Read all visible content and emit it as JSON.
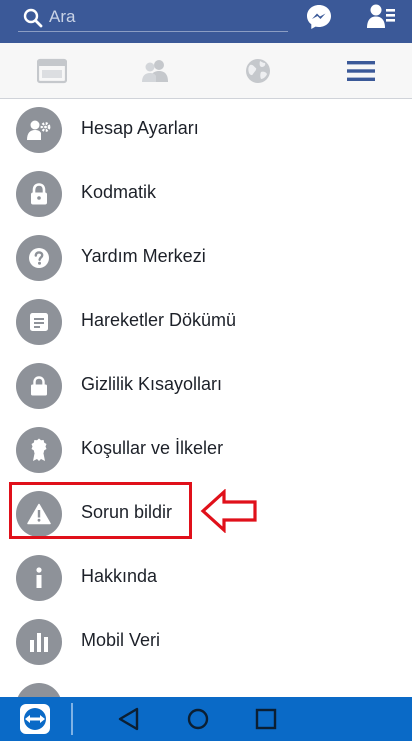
{
  "search": {
    "placeholder": "Ara"
  },
  "icons": {
    "search": "search-icon",
    "messenger": "messenger-icon",
    "friend_requests": "friend-requests-icon",
    "feed_tab": "news-feed-icon",
    "friends_tab": "friends-icon",
    "notifications_tab": "globe-icon",
    "menu_tab": "hamburger-menu-icon"
  },
  "menu": {
    "items": [
      {
        "label": "Hesap Ayarları",
        "icon": "account-settings-icon"
      },
      {
        "label": "Kodmatik",
        "icon": "padlock-icon"
      },
      {
        "label": "Yardım Merkezi",
        "icon": "help-icon"
      },
      {
        "label": "Hareketler Dökümü",
        "icon": "activity-log-icon"
      },
      {
        "label": "Gizlilik Kısayolları",
        "icon": "lock-icon"
      },
      {
        "label": "Koşullar ve İlkeler",
        "icon": "badge-icon"
      },
      {
        "label": "Sorun bildir",
        "icon": "warning-icon",
        "highlighted": true
      },
      {
        "label": "Hakkında",
        "icon": "info-icon"
      },
      {
        "label": "Mobil Veri",
        "icon": "bar-chart-icon"
      }
    ]
  },
  "colors": {
    "brand": "#3b5998",
    "icon_circle": "#8e9299",
    "highlight": "#e0101a",
    "navbar": "#0a6ac7"
  }
}
